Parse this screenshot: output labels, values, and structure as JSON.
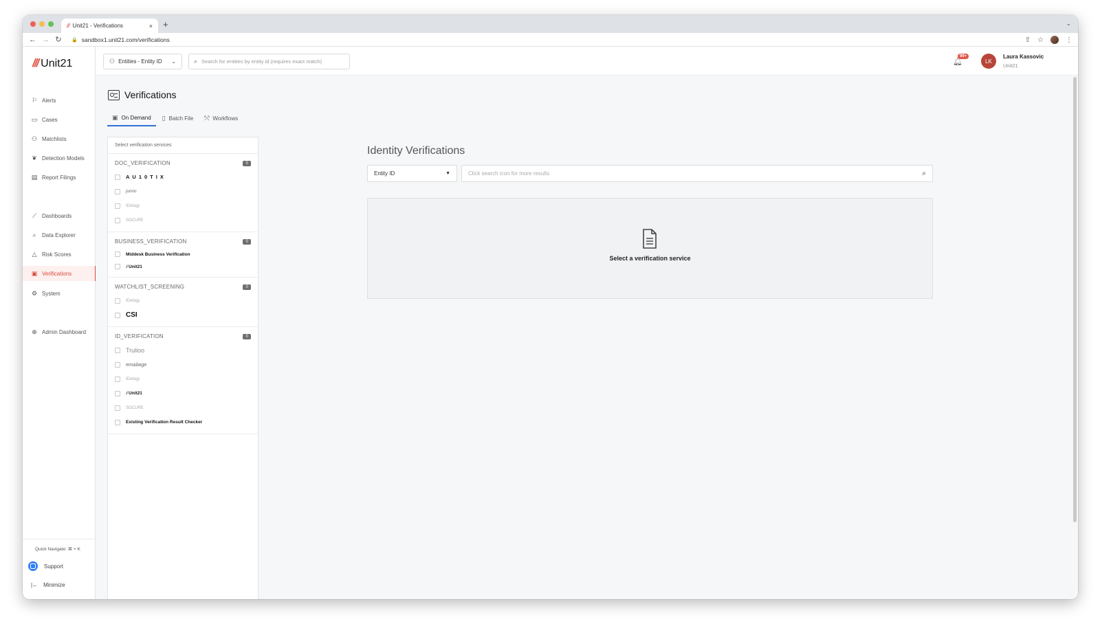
{
  "browser": {
    "tab_title": "Unit21 - Verifications",
    "url": "sandbox1.unit21.com/verifications"
  },
  "app": {
    "logo": "Unit21",
    "nav": [
      {
        "label": "Alerts",
        "icon": "flag-icon"
      },
      {
        "label": "Cases",
        "icon": "briefcase-icon"
      },
      {
        "label": "Matchlists",
        "icon": "user-plus-icon"
      },
      {
        "label": "Detection Models",
        "icon": "brain-icon"
      },
      {
        "label": "Report Filings",
        "icon": "building-icon"
      },
      {
        "label": "Dashboards",
        "icon": "chart-line-icon"
      },
      {
        "label": "Data Explorer",
        "icon": "search-doc-icon"
      },
      {
        "label": "Risk Scores",
        "icon": "warning-icon"
      },
      {
        "label": "Verifications",
        "icon": "id-card-icon"
      },
      {
        "label": "System",
        "icon": "gear-icon"
      },
      {
        "label": "Admin Dashboard",
        "icon": "globe-icon"
      }
    ],
    "quick_navigate": "Quick Navigate: ⌘ + K",
    "support": "Support",
    "minimize": "Minimize"
  },
  "header": {
    "entity_select": "Entities - Entity ID",
    "search_placeholder": "Search for entities by entity id (requires exact match)",
    "notifications_badge": "99+",
    "user": {
      "initials": "LK",
      "name": "Laura Kassovic",
      "org": "Unit21"
    }
  },
  "page": {
    "title": "Verifications",
    "tabs": [
      {
        "label": "On Demand",
        "active": true
      },
      {
        "label": "Batch File",
        "active": false
      },
      {
        "label": "Workflows",
        "active": false
      }
    ]
  },
  "services": {
    "header": "Select verification services",
    "groups": [
      {
        "name": "DOC_VERIFICATION",
        "count": "0",
        "items": [
          "AU10TIX",
          "jumio",
          "IDology",
          "SOCURE"
        ]
      },
      {
        "name": "BUSINESS_VERIFICATION",
        "count": "0",
        "items": [
          "Middesk Business Verification",
          "Unit21"
        ]
      },
      {
        "name": "WATCHLIST_SCREENING",
        "count": "0",
        "items": [
          "IDology",
          "CSI"
        ]
      },
      {
        "name": "ID_VERIFICATION",
        "count": "0",
        "items": [
          "Trulioo",
          "emailage",
          "IDology",
          "Unit21",
          "SOCURE",
          "Existing Verification Result Checker"
        ]
      }
    ]
  },
  "identity": {
    "title": "Identity Verifications",
    "select_value": "Entity ID",
    "search_placeholder": "Click search icon for more results",
    "empty_message": "Select a verification service"
  },
  "colors": {
    "brand": "#e05546",
    "tab_active": "#2f6fd6",
    "support": "#2f7ef6"
  }
}
